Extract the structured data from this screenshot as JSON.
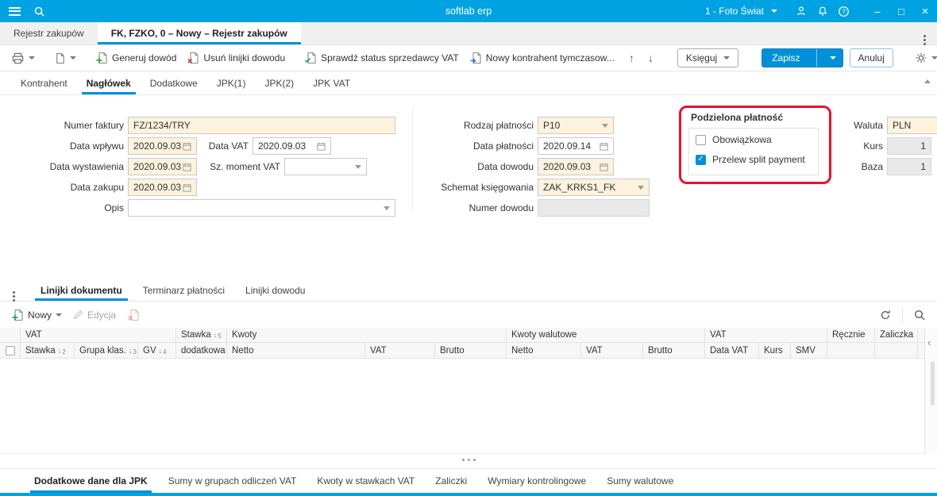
{
  "colors": {
    "titlebar": "#00A3E2",
    "accent": "#0090DA",
    "annotation": "#E8112D",
    "required_field": "#FCF2DE"
  },
  "titlebar": {
    "title": "softlab erp",
    "context_selector": "1 - Foto Świat",
    "minimize": "–",
    "maximize": "□",
    "close": "×"
  },
  "doc_tabs": {
    "inactive": "Rejestr zakupów",
    "active": "FK, FZKO, 0 – Nowy – Rejestr zakupów"
  },
  "toolbar": {
    "generate": "Generuj dowód",
    "delete_lines": "Usuń linijki dowodu",
    "check_vat": "Sprawdź status sprzedawcy VAT",
    "new_contractor": "Nowy kontrahent tymczasow...",
    "post": "Księguj",
    "save": "Zapisz",
    "cancel": "Anuluj",
    "arrow_up": "↑",
    "arrow_down": "↓"
  },
  "form_tabs": {
    "items": [
      "Kontrahent",
      "Nagłówek",
      "Dodatkowe",
      "JPK(1)",
      "JPK(2)",
      "JPK VAT"
    ],
    "active": "Nagłówek"
  },
  "form": {
    "numer_faktury": {
      "label": "Numer faktury",
      "value": "FZ/1234/TRY"
    },
    "data_wplywu": {
      "label": "Data wpływu",
      "value": "2020.09.03"
    },
    "data_vat": {
      "label": "Data VAT",
      "value": "2020.09.03"
    },
    "data_wystawienia": {
      "label": "Data wystawienia",
      "value": "2020.09.03"
    },
    "sz_moment_vat": {
      "label": "Sz. moment VAT",
      "value": ""
    },
    "data_zakupu": {
      "label": "Data zakupu",
      "value": "2020.09.03"
    },
    "opis": {
      "label": "Opis",
      "value": ""
    },
    "rodzaj_platnosci": {
      "label": "Rodzaj płatności",
      "value": "P10"
    },
    "data_platnosci": {
      "label": "Data płatności",
      "value": "2020.09.14"
    },
    "data_dowodu": {
      "label": "Data dowodu",
      "value": "2020.09.03"
    },
    "schemat_ksiegowania": {
      "label": "Schemat księgowania",
      "value": "ZAK_KRKS1_FK"
    },
    "numer_dowodu": {
      "label": "Numer dowodu",
      "value": ""
    },
    "split_payment": {
      "title": "Podzielona płatność",
      "obowiazkowa_label": "Obowiązkowa",
      "obowiazkowa_checked": false,
      "przelew_label": "Przelew split payment",
      "przelew_checked": true
    },
    "waluta": {
      "label": "Waluta",
      "value": "PLN"
    },
    "kurs": {
      "label": "Kurs",
      "value": "1"
    },
    "baza": {
      "label": "Baza",
      "value": "1"
    }
  },
  "lines": {
    "tabs": [
      "Linijki dokumentu",
      "Terminarz płatności",
      "Linijki dowodu"
    ],
    "active_tab": "Linijki dokumentu",
    "toolbar": {
      "new": "Nowy",
      "edit": "Edycja"
    },
    "grid": {
      "group_vat": "VAT",
      "group_kwoty": "Kwoty",
      "group_kwoty_walutowe": "Kwoty walutowe",
      "group_vat2": "VAT",
      "group_recznie": "Ręcznie",
      "group_zaliczka": "Zaliczka",
      "col_stawka": "Stawka",
      "col_grupa_klas": "Grupa klas.",
      "col_gv": "GV",
      "col_stawka_dodatkowa_line1": "Stawka",
      "col_stawka_dodatkowa_line2": "dodatkowa",
      "col_netto": "Netto",
      "col_vat": "VAT",
      "col_brutto": "Brutto",
      "col_netto_wal": "Netto",
      "col_vat_wal": "VAT",
      "col_brutto_wal": "Brutto",
      "col_data_vat": "Data VAT",
      "col_kurs": "Kurs",
      "col_smv": "SMV",
      "sort_arrow": "↓",
      "sort_stawka": "2",
      "sort_grupa": "3",
      "sort_gv": "4",
      "sort_stawka_dod": "5",
      "collapse_glyph": "‹",
      "rows": []
    }
  },
  "bottom_tabs": {
    "items": [
      "Dodatkowe dane dla JPK",
      "Sumy w grupach odliczeń VAT",
      "Kwoty w stawkach VAT",
      "Zaliczki",
      "Wymiary kontrolingowe",
      "Sumy walutowe"
    ],
    "active": "Dodatkowe dane dla JPK"
  }
}
